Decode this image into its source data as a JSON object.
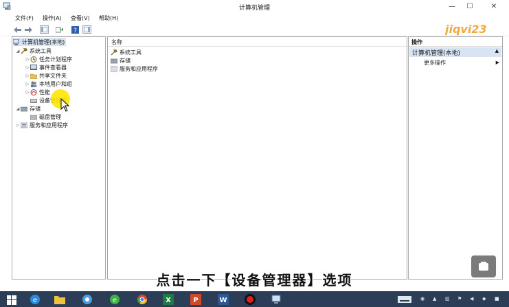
{
  "window": {
    "title": "计算机管理",
    "minimize": "—",
    "maximize": "☐",
    "close": "✕"
  },
  "menu": {
    "file": "文件(F)",
    "action": "操作(A)",
    "view": "查看(V)",
    "help": "帮助(H)"
  },
  "tree": {
    "root": "计算机管理(本地)",
    "system_tools": "系统工具",
    "task_scheduler": "任务计划程序",
    "event_viewer": "事件查看器",
    "shared_folders": "共享文件夹",
    "local_users": "本地用户和组",
    "performance": "性能",
    "device_manager": "设备管理器",
    "storage": "存储",
    "disk_management": "磁盘管理",
    "services_apps": "服务和应用程序"
  },
  "content": {
    "column_name": "名称",
    "items": [
      "系统工具",
      "存储",
      "服务和应用程序"
    ]
  },
  "actions": {
    "header": "操作",
    "selected": "计算机管理(本地)",
    "more": "更多操作"
  },
  "subtitle": "点击一下【设备管理器】选项",
  "watermark": "jiqvi23",
  "colors": {
    "taskbar": "#2c3e57",
    "selection": "#d9e4f3",
    "highlight": "#ffe600"
  }
}
